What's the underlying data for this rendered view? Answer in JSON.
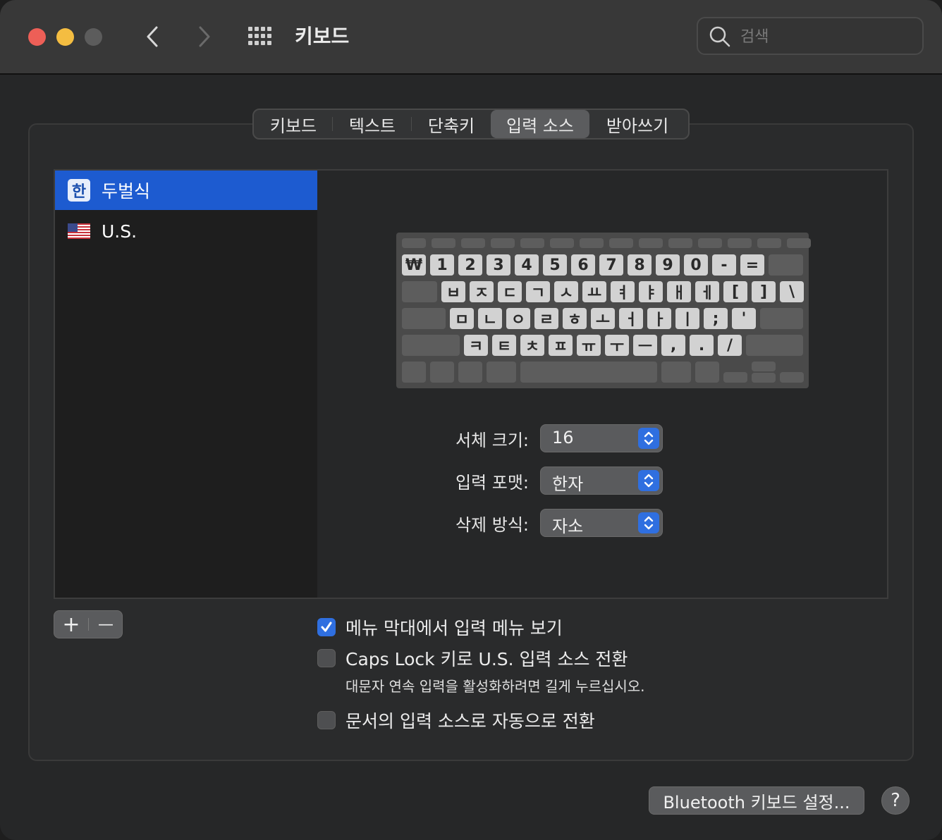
{
  "window": {
    "title": "키보드"
  },
  "search": {
    "placeholder": "검색"
  },
  "tabs": [
    {
      "label": "키보드"
    },
    {
      "label": "텍스트"
    },
    {
      "label": "단축키"
    },
    {
      "label": "입력 소스",
      "active": true
    },
    {
      "label": "받아쓰기"
    }
  ],
  "sources": [
    {
      "icon_glyph": "한",
      "label": "두벌식",
      "selected": true,
      "icon": "hangul-icon"
    },
    {
      "label": "U.S.",
      "selected": false,
      "icon": "us-flag-icon"
    }
  ],
  "keyboard": {
    "row1": [
      "₩",
      "1",
      "2",
      "3",
      "4",
      "5",
      "6",
      "7",
      "8",
      "9",
      "0",
      "-",
      "="
    ],
    "row2": [
      "ㅂ",
      "ㅈ",
      "ㄷ",
      "ㄱ",
      "ㅅ",
      "ㅛ",
      "ㅕ",
      "ㅑ",
      "ㅐ",
      "ㅔ",
      "[",
      "]",
      "\\"
    ],
    "row3": [
      "ㅁ",
      "ㄴ",
      "ㅇ",
      "ㄹ",
      "ㅎ",
      "ㅗ",
      "ㅓ",
      "ㅏ",
      "ㅣ",
      ";",
      "'"
    ],
    "row4": [
      "ㅋ",
      "ㅌ",
      "ㅊ",
      "ㅍ",
      "ㅠ",
      "ㅜ",
      "ㅡ",
      ",",
      ".",
      "/"
    ]
  },
  "settings": {
    "font_size": {
      "label": "서체 크기:",
      "value": "16"
    },
    "input_format": {
      "label": "입력 포맷:",
      "value": "한자"
    },
    "delete_mode": {
      "label": "삭제 방식:",
      "value": "자소"
    }
  },
  "list_controls": {
    "add": "+",
    "remove": "—"
  },
  "options": {
    "show_menu": {
      "label": "메뉴 막대에서 입력 메뉴 보기",
      "checked": true
    },
    "caps_lock": {
      "label": "Caps Lock 키로 U.S. 입력 소스 전환",
      "checked": false
    },
    "caps_hint": "대문자 연속 입력을 활성화하려면 길게 누르십시오.",
    "auto_switch": {
      "label": "문서의 입력 소스로 자동으로 전환",
      "checked": false
    }
  },
  "footer": {
    "bluetooth_button": "Bluetooth 키보드 설정...",
    "help": "?"
  },
  "colors": {
    "accent": "#2f6fe0",
    "selection": "#1d5bd0"
  }
}
